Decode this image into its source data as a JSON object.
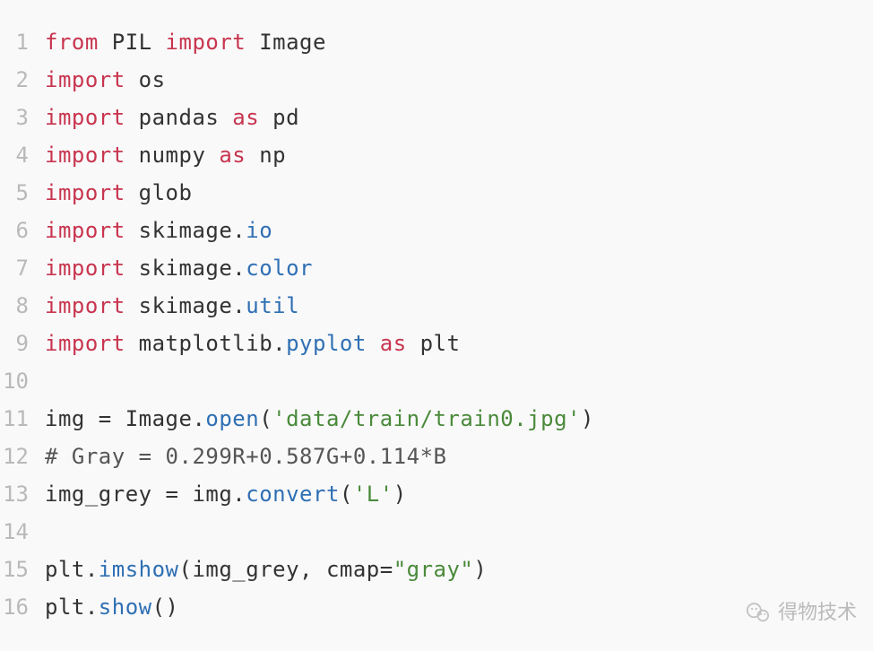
{
  "code": {
    "lines": [
      {
        "n": 1,
        "tokens": [
          {
            "cls": "kw-red",
            "t": "from"
          },
          {
            "cls": "",
            "t": " PIL "
          },
          {
            "cls": "kw-red",
            "t": "import"
          },
          {
            "cls": "",
            "t": " Image"
          }
        ]
      },
      {
        "n": 2,
        "tokens": [
          {
            "cls": "kw-red",
            "t": "import"
          },
          {
            "cls": "",
            "t": " os"
          }
        ]
      },
      {
        "n": 3,
        "tokens": [
          {
            "cls": "kw-red",
            "t": "import"
          },
          {
            "cls": "",
            "t": " pandas "
          },
          {
            "cls": "kw-red",
            "t": "as"
          },
          {
            "cls": "",
            "t": " pd"
          }
        ]
      },
      {
        "n": 4,
        "tokens": [
          {
            "cls": "kw-red",
            "t": "import"
          },
          {
            "cls": "",
            "t": " numpy "
          },
          {
            "cls": "kw-red",
            "t": "as"
          },
          {
            "cls": "",
            "t": " np"
          }
        ]
      },
      {
        "n": 5,
        "tokens": [
          {
            "cls": "kw-red",
            "t": "import"
          },
          {
            "cls": "",
            "t": " glob"
          }
        ]
      },
      {
        "n": 6,
        "tokens": [
          {
            "cls": "kw-red",
            "t": "import"
          },
          {
            "cls": "",
            "t": " skimage."
          },
          {
            "cls": "fn-blue",
            "t": "io"
          }
        ]
      },
      {
        "n": 7,
        "tokens": [
          {
            "cls": "kw-red",
            "t": "import"
          },
          {
            "cls": "",
            "t": " skimage."
          },
          {
            "cls": "fn-blue",
            "t": "color"
          }
        ]
      },
      {
        "n": 8,
        "tokens": [
          {
            "cls": "kw-red",
            "t": "import"
          },
          {
            "cls": "",
            "t": " skimage."
          },
          {
            "cls": "fn-blue",
            "t": "util"
          }
        ]
      },
      {
        "n": 9,
        "tokens": [
          {
            "cls": "kw-red",
            "t": "import"
          },
          {
            "cls": "",
            "t": " matplotlib."
          },
          {
            "cls": "fn-blue",
            "t": "pyplot"
          },
          {
            "cls": "",
            "t": " "
          },
          {
            "cls": "kw-red",
            "t": "as"
          },
          {
            "cls": "",
            "t": " plt"
          }
        ]
      },
      {
        "n": 10,
        "tokens": []
      },
      {
        "n": 11,
        "tokens": [
          {
            "cls": "",
            "t": "img = Image."
          },
          {
            "cls": "fn-blue",
            "t": "open"
          },
          {
            "cls": "",
            "t": "("
          },
          {
            "cls": "str-green",
            "t": "'data/train/train0.jpg'"
          },
          {
            "cls": "",
            "t": ")"
          }
        ]
      },
      {
        "n": 12,
        "tokens": [
          {
            "cls": "comment",
            "t": "# Gray = 0.299R+0.587G+0.114*B"
          }
        ]
      },
      {
        "n": 13,
        "tokens": [
          {
            "cls": "",
            "t": "img_grey = img."
          },
          {
            "cls": "fn-blue",
            "t": "convert"
          },
          {
            "cls": "",
            "t": "("
          },
          {
            "cls": "str-green",
            "t": "'L'"
          },
          {
            "cls": "",
            "t": ")"
          }
        ]
      },
      {
        "n": 14,
        "tokens": []
      },
      {
        "n": 15,
        "tokens": [
          {
            "cls": "",
            "t": "plt."
          },
          {
            "cls": "fn-blue",
            "t": "imshow"
          },
          {
            "cls": "",
            "t": "(img_grey, cmap="
          },
          {
            "cls": "str-green",
            "t": "\"gray\""
          },
          {
            "cls": "",
            "t": ")"
          }
        ]
      },
      {
        "n": 16,
        "tokens": [
          {
            "cls": "",
            "t": "plt."
          },
          {
            "cls": "fn-blue",
            "t": "show"
          },
          {
            "cls": "",
            "t": "()"
          }
        ]
      }
    ]
  },
  "watermark": {
    "text": "得物技术"
  }
}
